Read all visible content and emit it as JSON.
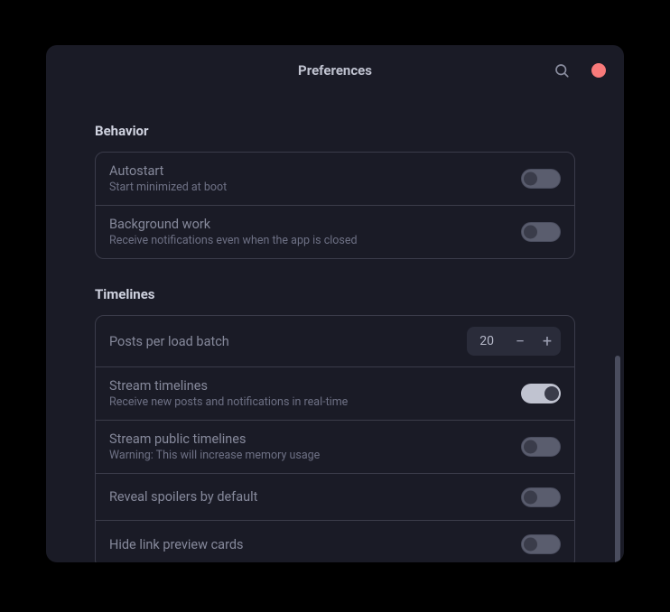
{
  "header": {
    "title": "Preferences"
  },
  "sections": {
    "behavior": {
      "title": "Behavior",
      "autostart": {
        "label": "Autostart",
        "sub": "Start minimized at boot"
      },
      "background": {
        "label": "Background work",
        "sub": "Receive notifications even when the app is closed"
      }
    },
    "timelines": {
      "title": "Timelines",
      "batch": {
        "label": "Posts per load batch",
        "value": "20"
      },
      "stream": {
        "label": "Stream timelines",
        "sub": "Receive new posts and notifications in real-time"
      },
      "streamPublic": {
        "label": "Stream public timelines",
        "sub": "Warning: This will increase memory usage"
      },
      "spoilers": {
        "label": "Reveal spoilers by default"
      },
      "hideLink": {
        "label": "Hide link preview cards"
      }
    }
  },
  "icons": {
    "minus": "−",
    "plus": "+"
  }
}
